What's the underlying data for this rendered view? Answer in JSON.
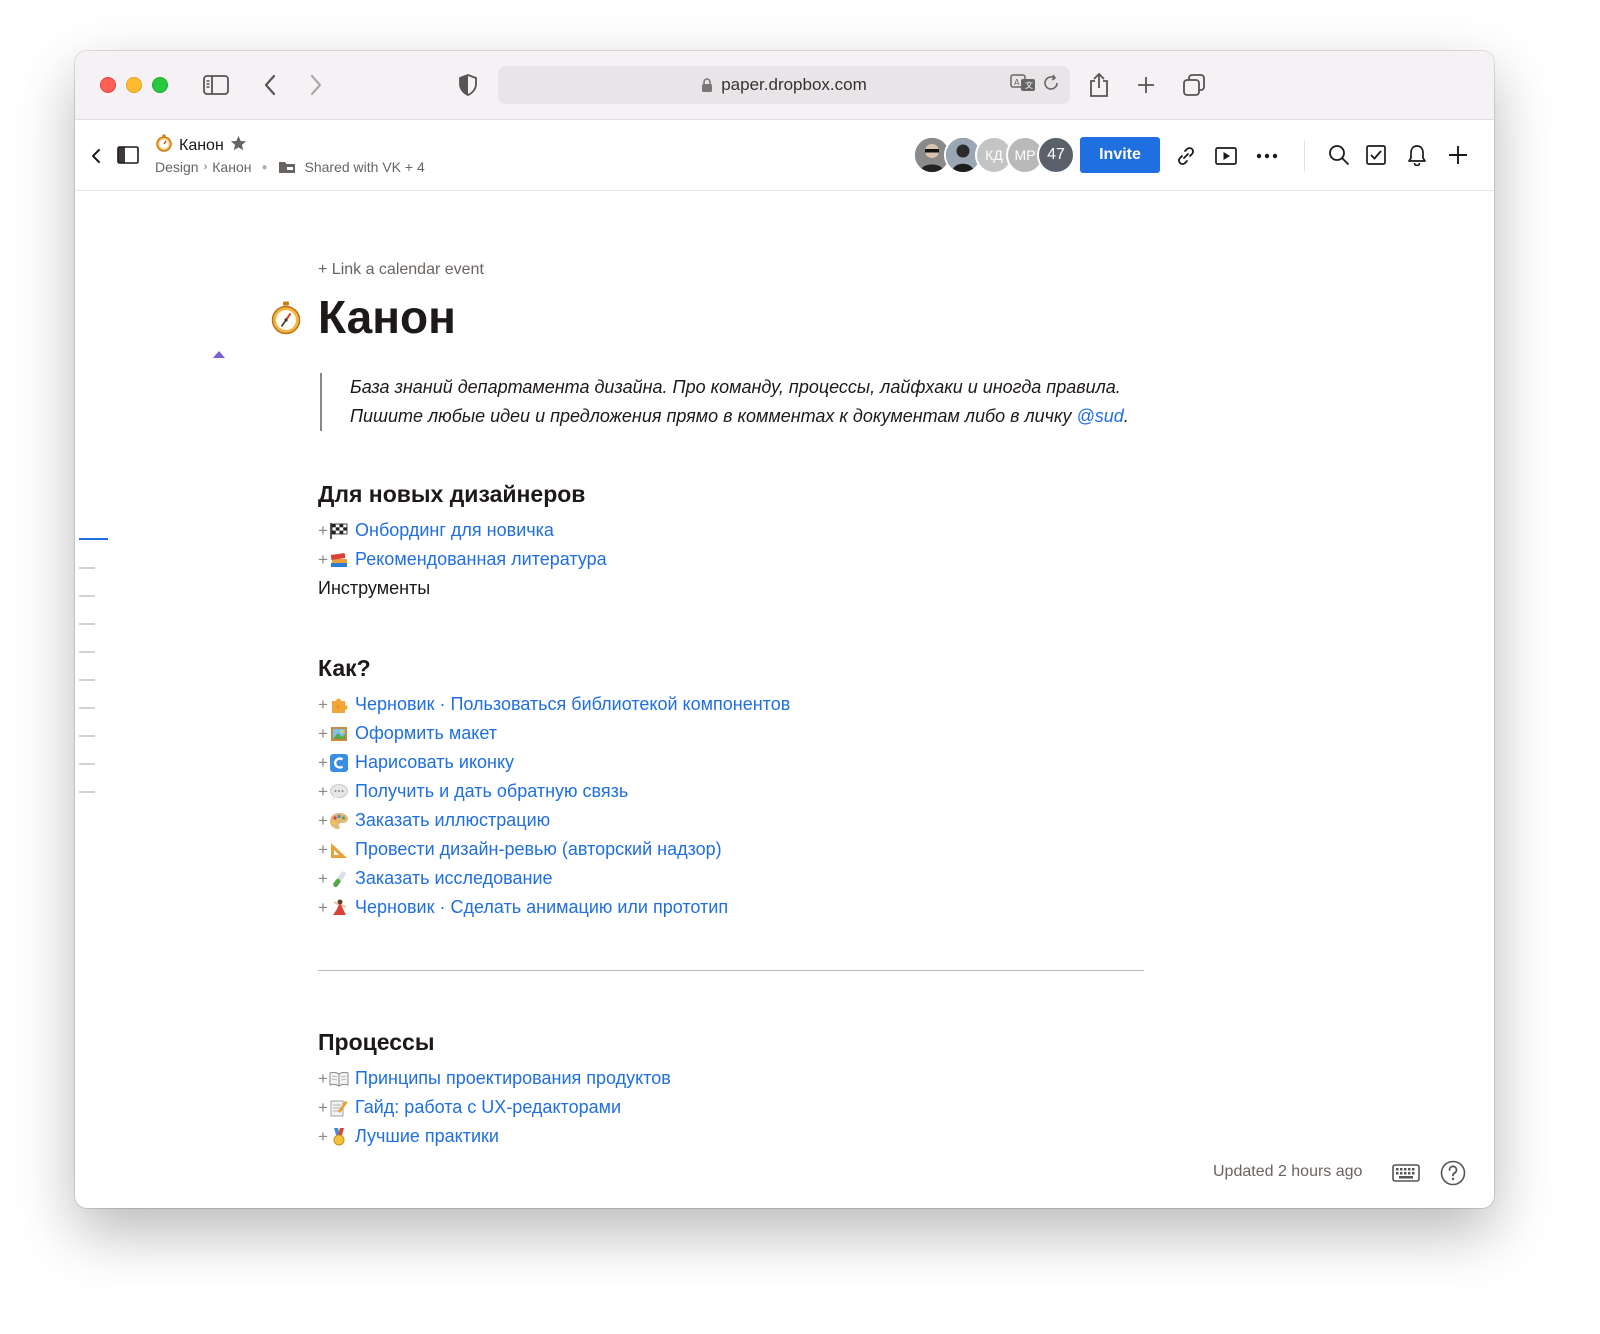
{
  "browser": {
    "url": "paper.dropbox.com"
  },
  "header": {
    "doc_title": "Канон",
    "breadcrumb": [
      "Design",
      "Канон"
    ],
    "shared_label": "Shared with VK + 4",
    "avatars": [
      {
        "initials": "",
        "color": "#4a4a4a"
      },
      {
        "initials": "",
        "color": "#3d4450"
      },
      {
        "initials": "КД",
        "color": "#c4c4c4"
      },
      {
        "initials": "МР",
        "color": "#b9b9b9"
      },
      {
        "initials": "47",
        "color": "#5a616b"
      }
    ],
    "invite_label": "Invite"
  },
  "doc": {
    "calendar_link": "+ Link a calendar event",
    "title": "Канон",
    "quote_text": "База знаний департамента дизайна. Про команду, процессы, лайфхаки и иногда правила. Пишите любые идеи и предложения прямо в комментах к документам либо в личку ",
    "quote_mention": "@sud",
    "quote_end": ".",
    "sections": [
      {
        "heading": "Для новых дизайнеров",
        "items": [
          {
            "emoji": "checkered-flag",
            "label": "Онбординг для новичка"
          },
          {
            "emoji": "books",
            "label": "Рекомендованная литература"
          }
        ],
        "plain": "Инструменты"
      },
      {
        "heading": "Как?",
        "items": [
          {
            "emoji": "puzzle",
            "label": "Черновик · Пользоваться библиотекой компонентов"
          },
          {
            "emoji": "framed-picture",
            "label": "Оформить макет"
          },
          {
            "emoji": "c-letter",
            "label": "Нарисовать иконку"
          },
          {
            "emoji": "speech-balloon",
            "label": "Получить и дать обратную связь"
          },
          {
            "emoji": "palette",
            "label": "Заказать иллюстрацию"
          },
          {
            "emoji": "triangular-ruler",
            "label": "Провести дизайн-ревью (авторский надзор)"
          },
          {
            "emoji": "test-tube",
            "label": "Заказать исследование"
          },
          {
            "emoji": "dancer",
            "label": "Черновик · Сделать анимацию или прототип"
          }
        ]
      },
      {
        "heading": "Процессы",
        "items": [
          {
            "emoji": "open-book",
            "label": "Принципы проектирования продуктов"
          },
          {
            "emoji": "memo",
            "label": "Гайд: работа с UX-редакторами"
          },
          {
            "emoji": "medal",
            "label": "Лучшие практики"
          }
        ]
      }
    ]
  },
  "footer": {
    "updated": "Updated 2 hours ago"
  },
  "colors": {
    "accent": "#1f6fe0",
    "link": "#1f6fe0",
    "text": "#1e1919",
    "muted": "#6a6461"
  }
}
